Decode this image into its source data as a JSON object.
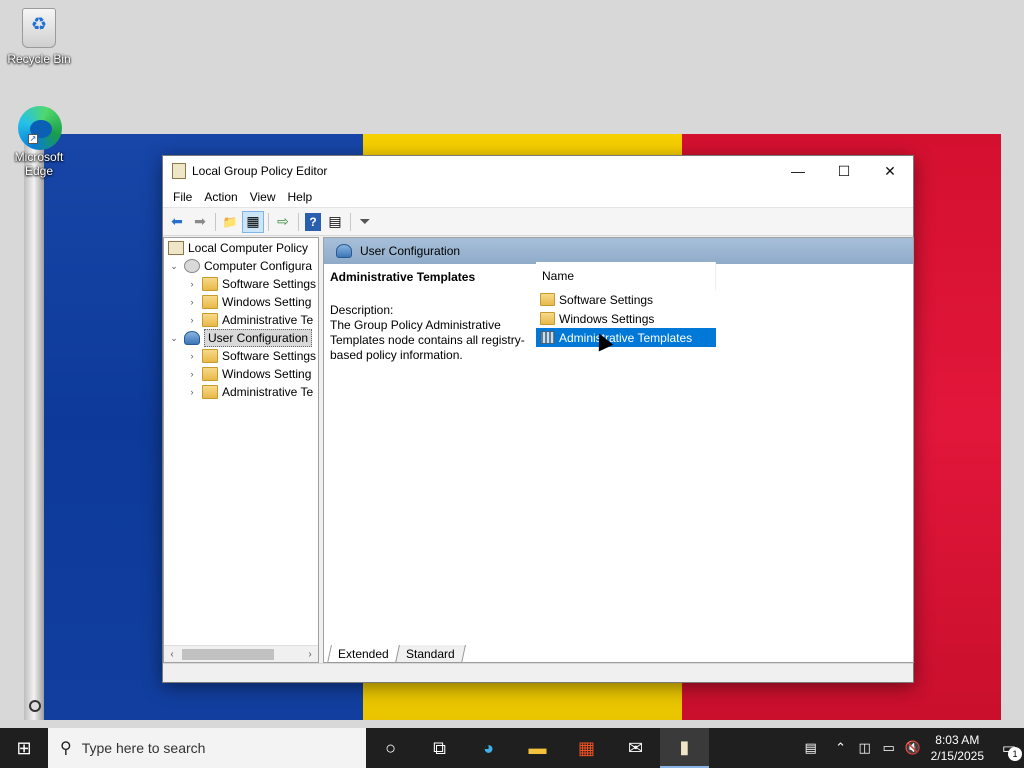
{
  "desktop": {
    "icons": [
      {
        "label": "Recycle Bin",
        "icon": "recycle-bin-icon"
      },
      {
        "label": "Microsoft Edge",
        "icon": "edge-icon"
      }
    ]
  },
  "window": {
    "title": "Local Group Policy Editor",
    "controls": {
      "minimize": "—",
      "maximize": "☐",
      "close": "✕"
    },
    "menu": [
      "File",
      "Action",
      "View",
      "Help"
    ],
    "toolbar": [
      {
        "icon": "back-arrow-icon",
        "glyph": "⬅"
      },
      {
        "icon": "forward-arrow-icon",
        "glyph": "➡"
      },
      {
        "icon": "up-folder-icon",
        "glyph": "📁"
      },
      {
        "icon": "show-hide-tree-icon",
        "glyph": "▦"
      },
      {
        "icon": "export-list-icon",
        "glyph": "⇨"
      },
      {
        "icon": "help-icon",
        "glyph": "?"
      },
      {
        "icon": "properties-icon",
        "glyph": "▤"
      },
      {
        "icon": "filter-icon",
        "glyph": "⏷"
      }
    ],
    "tree": {
      "root": "Local Computer Policy",
      "computer_config": "Computer Configura",
      "computer_children": [
        "Software Settings",
        "Windows Setting",
        "Administrative Te"
      ],
      "user_config": "User Configuration",
      "user_children": [
        "Software Settings",
        "Windows Setting",
        "Administrative Te"
      ]
    },
    "right_header": "User Configuration",
    "description": {
      "heading": "Administrative Templates",
      "label": "Description:",
      "text": "The Group Policy Administrative Templates node contains all registry-based policy information."
    },
    "list": {
      "column": "Name",
      "items": [
        "Software Settings",
        "Windows Settings",
        "Administrative Templates"
      ],
      "selected": "Administrative Templates"
    },
    "tabs": [
      "Extended",
      "Standard"
    ]
  },
  "taskbar": {
    "search_placeholder": "Type here to search",
    "time": "8:03 AM",
    "date": "2/15/2025",
    "notification_count": "1"
  }
}
